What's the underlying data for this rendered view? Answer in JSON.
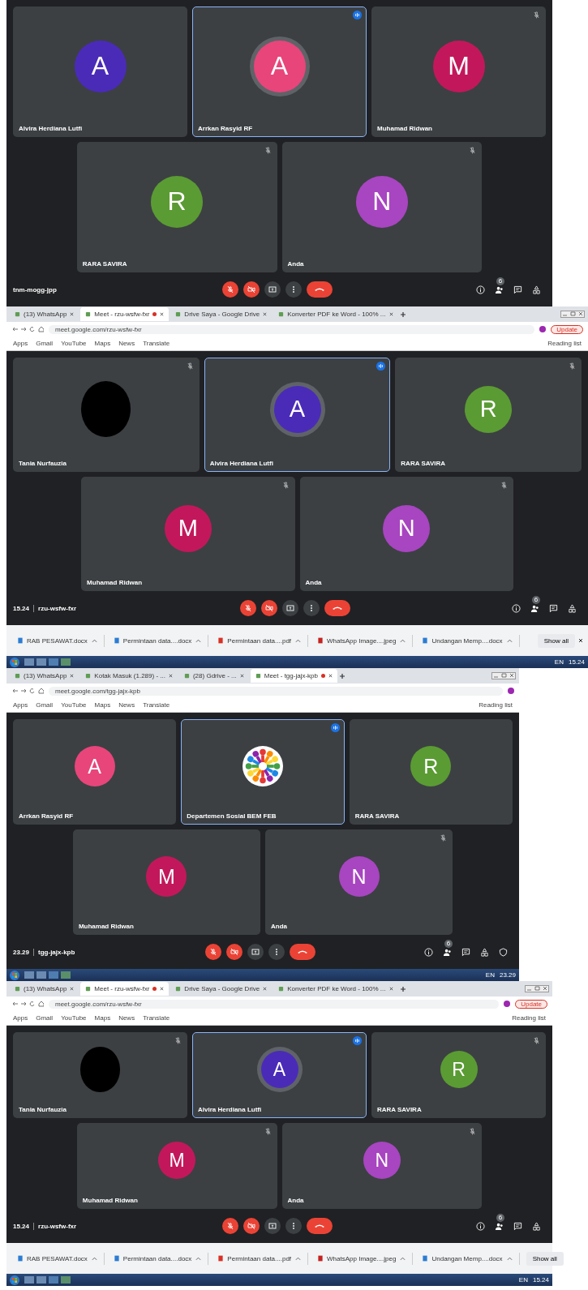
{
  "screens": [
    {
      "meet": {
        "tiles_top": [
          {
            "name": "Alvira Herdiana Lutfi",
            "initial": "A",
            "kind": "letter",
            "color": "#4a2bb8",
            "muted": false,
            "speaking": false
          },
          {
            "name": "Arrkan Rasyid RF",
            "initial": "A",
            "kind": "letter",
            "color": "#e8457a",
            "muted": false,
            "speaking": true
          },
          {
            "name": "Muhamad Ridwan",
            "initial": "M",
            "kind": "letter",
            "color": "#c2185b",
            "muted": true,
            "speaking": false
          }
        ],
        "tiles_bottom": [
          {
            "name": "RARA SAVIRA",
            "initial": "R",
            "kind": "letter",
            "color": "#5b9b33",
            "muted": true,
            "speaking": false
          },
          {
            "name": "Anda",
            "initial": "N",
            "kind": "letter",
            "color": "#a845c0",
            "muted": true,
            "speaking": false
          }
        ],
        "code": "tnm-mogg-jpp",
        "participant_count": "6"
      }
    },
    {
      "browser": {
        "tabs": [
          {
            "label": "(13) WhatsApp",
            "selected": false,
            "recording": false
          },
          {
            "label": "Meet - rzu-wsfw-fxr",
            "selected": true,
            "recording": true
          },
          {
            "label": "Drive Saya - Google Drive",
            "selected": false,
            "recording": false
          },
          {
            "label": "Konverter PDF ke Word - 100% ...",
            "selected": false,
            "recording": false
          }
        ],
        "address": "meet.google.com/rzu-wsfw-fxr",
        "bookmarks": [
          "Apps",
          "Gmail",
          "YouTube",
          "Maps",
          "News",
          "Translate"
        ],
        "reading_list": "Reading list",
        "update_label": "Update"
      },
      "meet": {
        "tiles_top": [
          {
            "name": "Tania Nurfauzia",
            "kind": "photo",
            "color": "#000000",
            "muted": true,
            "speaking": false
          },
          {
            "name": "Alvira Herdiana Lutfi",
            "initial": "A",
            "kind": "letter",
            "color": "#4a2bb8",
            "muted": false,
            "speaking": true
          },
          {
            "name": "RARA SAVIRA",
            "initial": "R",
            "kind": "letter",
            "color": "#5b9b33",
            "muted": true,
            "speaking": false
          }
        ],
        "tiles_bottom": [
          {
            "name": "Muhamad Ridwan",
            "initial": "M",
            "kind": "letter",
            "color": "#c2185b",
            "muted": true,
            "speaking": false
          },
          {
            "name": "Anda",
            "initial": "N",
            "kind": "letter",
            "color": "#a845c0",
            "muted": true,
            "speaking": false
          }
        ],
        "time": "15.24",
        "code": "rzu-wsfw-fxr",
        "participant_count": "6"
      },
      "downloads": {
        "items": [
          {
            "label": "RAB PESAWAT.docx",
            "kind": "doc"
          },
          {
            "label": "Permintaan data....docx",
            "kind": "doc"
          },
          {
            "label": "Permintaan data....pdf",
            "kind": "pdf"
          },
          {
            "label": "WhatsApp Image....jpeg",
            "kind": "image"
          },
          {
            "label": "Undangan Memp....docx",
            "kind": "doc"
          }
        ],
        "show_all": "Show all"
      },
      "taskbar": {
        "language": "EN",
        "clock": "15.24"
      }
    },
    {
      "browser": {
        "tabs": [
          {
            "label": "(13) WhatsApp",
            "selected": false,
            "recording": false
          },
          {
            "label": "Kotak Masuk (1.289) - ...",
            "selected": false,
            "recording": false
          },
          {
            "label": "(28) Gdrive - ...",
            "selected": false,
            "recording": false
          },
          {
            "label": "Meet - tgg-jajx-kpb",
            "selected": true,
            "recording": true
          }
        ],
        "address": "meet.google.com/tgg-jajx-kpb",
        "bookmarks": [
          "Apps",
          "Gmail",
          "YouTube",
          "Maps",
          "News",
          "Translate"
        ],
        "reading_list": "Reading list"
      },
      "meet": {
        "tiles_top": [
          {
            "name": "Arrkan Rasyid RF",
            "initial": "A",
            "kind": "letter",
            "color": "#e8457a",
            "muted": false,
            "speaking": false
          },
          {
            "name": "Departemen Sosial BEM FEB",
            "kind": "logo",
            "color": "#ffffff",
            "muted": false,
            "speaking": true
          },
          {
            "name": "RARA SAVIRA",
            "initial": "R",
            "kind": "letter",
            "color": "#5b9b33",
            "muted": false,
            "speaking": false
          }
        ],
        "tiles_bottom": [
          {
            "name": "Muhamad Ridwan",
            "initial": "M",
            "kind": "letter",
            "color": "#c2185b",
            "muted": false,
            "speaking": false
          },
          {
            "name": "Anda",
            "initial": "N",
            "kind": "letter",
            "color": "#a845c0",
            "muted": true,
            "speaking": false
          }
        ],
        "time": "23.29",
        "code": "tgg-jajx-kpb",
        "participant_count": "6",
        "host_controls": true
      },
      "taskbar": {
        "language": "EN",
        "clock": "23.29"
      }
    },
    {
      "browser": {
        "tabs": [
          {
            "label": "(13) WhatsApp",
            "selected": false,
            "recording": false
          },
          {
            "label": "Meet - rzu-wsfw-fxr",
            "selected": true,
            "recording": true
          },
          {
            "label": "Drive Saya - Google Drive",
            "selected": false,
            "recording": false
          },
          {
            "label": "Konverter PDF ke Word - 100% ...",
            "selected": false,
            "recording": false
          }
        ],
        "address": "meet.google.com/rzu-wsfw-fxr",
        "bookmarks": [
          "Apps",
          "Gmail",
          "YouTube",
          "Maps",
          "News",
          "Translate"
        ],
        "reading_list": "Reading list",
        "update_label": "Update"
      },
      "meet": {
        "tiles_top": [
          {
            "name": "Tania Nurfauzia",
            "kind": "photo",
            "color": "#000000",
            "muted": true,
            "speaking": false
          },
          {
            "name": "Alvira Herdiana Lutfi",
            "initial": "A",
            "kind": "letter",
            "color": "#4a2bb8",
            "muted": false,
            "speaking": true
          },
          {
            "name": "RARA SAVIRA",
            "initial": "R",
            "kind": "letter",
            "color": "#5b9b33",
            "muted": true,
            "speaking": false
          }
        ],
        "tiles_bottom": [
          {
            "name": "Muhamad Ridwan",
            "initial": "M",
            "kind": "letter",
            "color": "#c2185b",
            "muted": true,
            "speaking": false
          },
          {
            "name": "Anda",
            "initial": "N",
            "kind": "letter",
            "color": "#a845c0",
            "muted": true,
            "speaking": false
          }
        ],
        "time": "15.24",
        "code": "rzu-wsfw-fxr",
        "participant_count": "6"
      },
      "downloads": {
        "items": [
          {
            "label": "RAB PESAWAT.docx",
            "kind": "doc"
          },
          {
            "label": "Permintaan data....docx",
            "kind": "doc"
          },
          {
            "label": "Permintaan data....pdf",
            "kind": "pdf"
          },
          {
            "label": "WhatsApp Image....jpeg",
            "kind": "image"
          },
          {
            "label": "Undangan Memp....docx",
            "kind": "doc"
          }
        ],
        "show_all": "Show all"
      },
      "taskbar": {
        "language": "EN",
        "clock": "15.24"
      }
    }
  ]
}
